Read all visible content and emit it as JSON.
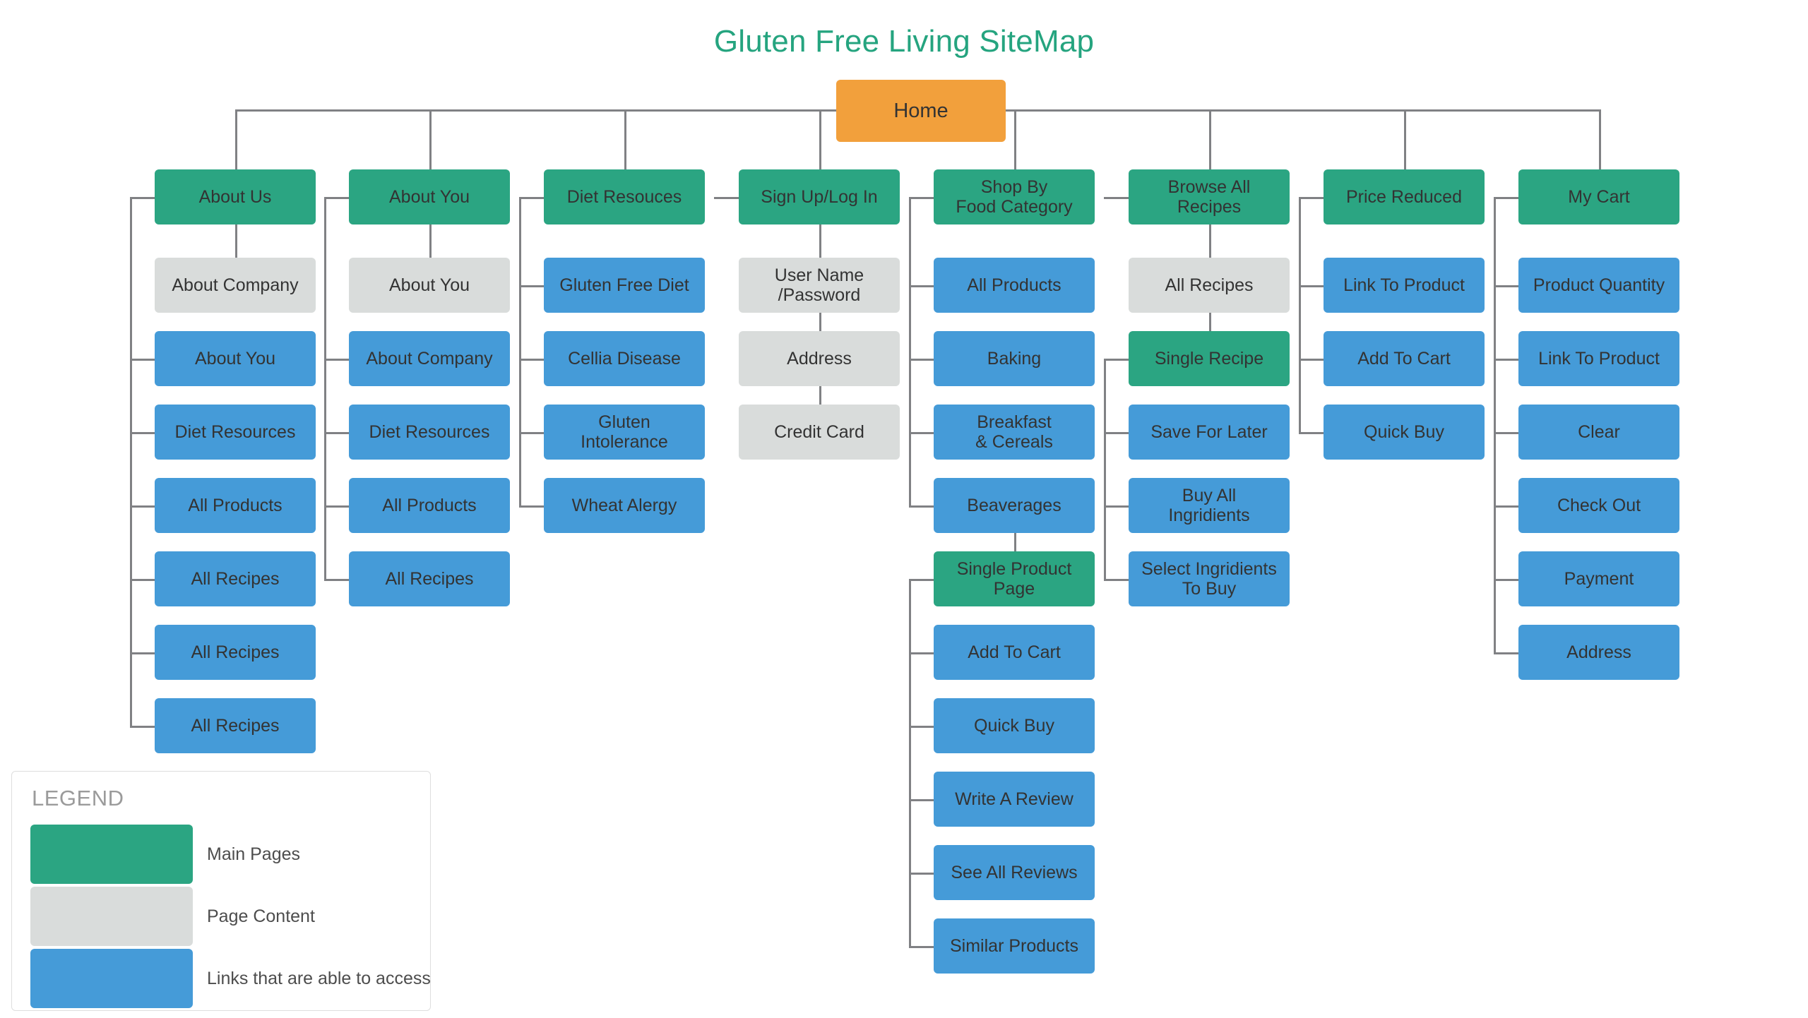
{
  "title": "Gluten Free Living SiteMap",
  "colors": {
    "main_pages": "#2ba582",
    "page_content": "#d9dcdb",
    "links": "#459bd8",
    "home": "#f2a03c",
    "title_text": "#25a47f",
    "connector": "#808184"
  },
  "root": {
    "label": "Home",
    "type": "home"
  },
  "columns": [
    {
      "id": "about-us",
      "header": {
        "label": "About Us",
        "type": "main"
      },
      "children": [
        {
          "label": "About Company",
          "type": "content"
        },
        {
          "label": "About You",
          "type": "link"
        },
        {
          "label": "Diet Resources",
          "type": "link"
        },
        {
          "label": "All Products",
          "type": "link"
        },
        {
          "label": "All Recipes",
          "type": "link"
        },
        {
          "label": "All Recipes",
          "type": "link"
        },
        {
          "label": "All Recipes",
          "type": "link"
        }
      ]
    },
    {
      "id": "about-you",
      "header": {
        "label": "About You",
        "type": "main"
      },
      "children": [
        {
          "label": "About You",
          "type": "content"
        },
        {
          "label": "About Company",
          "type": "link"
        },
        {
          "label": "Diet Resources",
          "type": "link"
        },
        {
          "label": "All Products",
          "type": "link"
        },
        {
          "label": "All Recipes",
          "type": "link"
        }
      ]
    },
    {
      "id": "diet-resouces",
      "header": {
        "label": "Diet Resouces",
        "type": "main"
      },
      "children": [
        {
          "label": "Gluten Free Diet",
          "type": "link"
        },
        {
          "label": "Cellia Disease",
          "type": "link"
        },
        {
          "label": "Gluten\nIntolerance",
          "type": "link"
        },
        {
          "label": "Wheat Alergy",
          "type": "link"
        }
      ]
    },
    {
      "id": "sign-up-log-in",
      "header": {
        "label": "Sign Up/Log In",
        "type": "main"
      },
      "children": [
        {
          "label": "User Name\n/Password",
          "type": "content"
        },
        {
          "label": "Address",
          "type": "content"
        },
        {
          "label": "Credit Card",
          "type": "content"
        }
      ]
    },
    {
      "id": "shop-by-food-category",
      "header": {
        "label": "Shop By\nFood Category",
        "type": "main"
      },
      "children": [
        {
          "label": "All Products",
          "type": "link"
        },
        {
          "label": "Baking",
          "type": "link"
        },
        {
          "label": "Breakfast\n& Cereals",
          "type": "link"
        },
        {
          "label": "Beaverages",
          "type": "link"
        },
        {
          "label": "Single Product\nPage",
          "type": "main"
        },
        {
          "label": "Add To Cart",
          "type": "link"
        },
        {
          "label": "Quick Buy",
          "type": "link"
        },
        {
          "label": "Write A Review",
          "type": "link"
        },
        {
          "label": "See All Reviews",
          "type": "link"
        },
        {
          "label": "Similar Products",
          "type": "link"
        }
      ]
    },
    {
      "id": "browse-all-recipes",
      "header": {
        "label": "Browse All\nRecipes",
        "type": "main"
      },
      "children": [
        {
          "label": "All Recipes",
          "type": "content"
        },
        {
          "label": "Single Recipe",
          "type": "main"
        },
        {
          "label": "Save For Later",
          "type": "link"
        },
        {
          "label": "Buy All\nIngridients",
          "type": "link"
        },
        {
          "label": "Select Ingridients\nTo Buy",
          "type": "link"
        }
      ]
    },
    {
      "id": "price-reduced",
      "header": {
        "label": "Price Reduced",
        "type": "main"
      },
      "children": [
        {
          "label": "Link To Product",
          "type": "link"
        },
        {
          "label": "Add To Cart",
          "type": "link"
        },
        {
          "label": "Quick Buy",
          "type": "link"
        }
      ]
    },
    {
      "id": "my-cart",
      "header": {
        "label": "My Cart",
        "type": "main"
      },
      "children": [
        {
          "label": "Product Quantity",
          "type": "link"
        },
        {
          "label": "Link To Product",
          "type": "link"
        },
        {
          "label": "Clear",
          "type": "link"
        },
        {
          "label": "Check Out",
          "type": "link"
        },
        {
          "label": "Payment",
          "type": "link"
        },
        {
          "label": "Address",
          "type": "link"
        }
      ]
    }
  ],
  "legend": {
    "title": "LEGEND",
    "items": [
      {
        "label": "Main Pages",
        "color": "#2ba582"
      },
      {
        "label": "Page Content",
        "color": "#d9dcdb"
      },
      {
        "label": "Links that are able to access",
        "color": "#459bd8"
      }
    ]
  }
}
